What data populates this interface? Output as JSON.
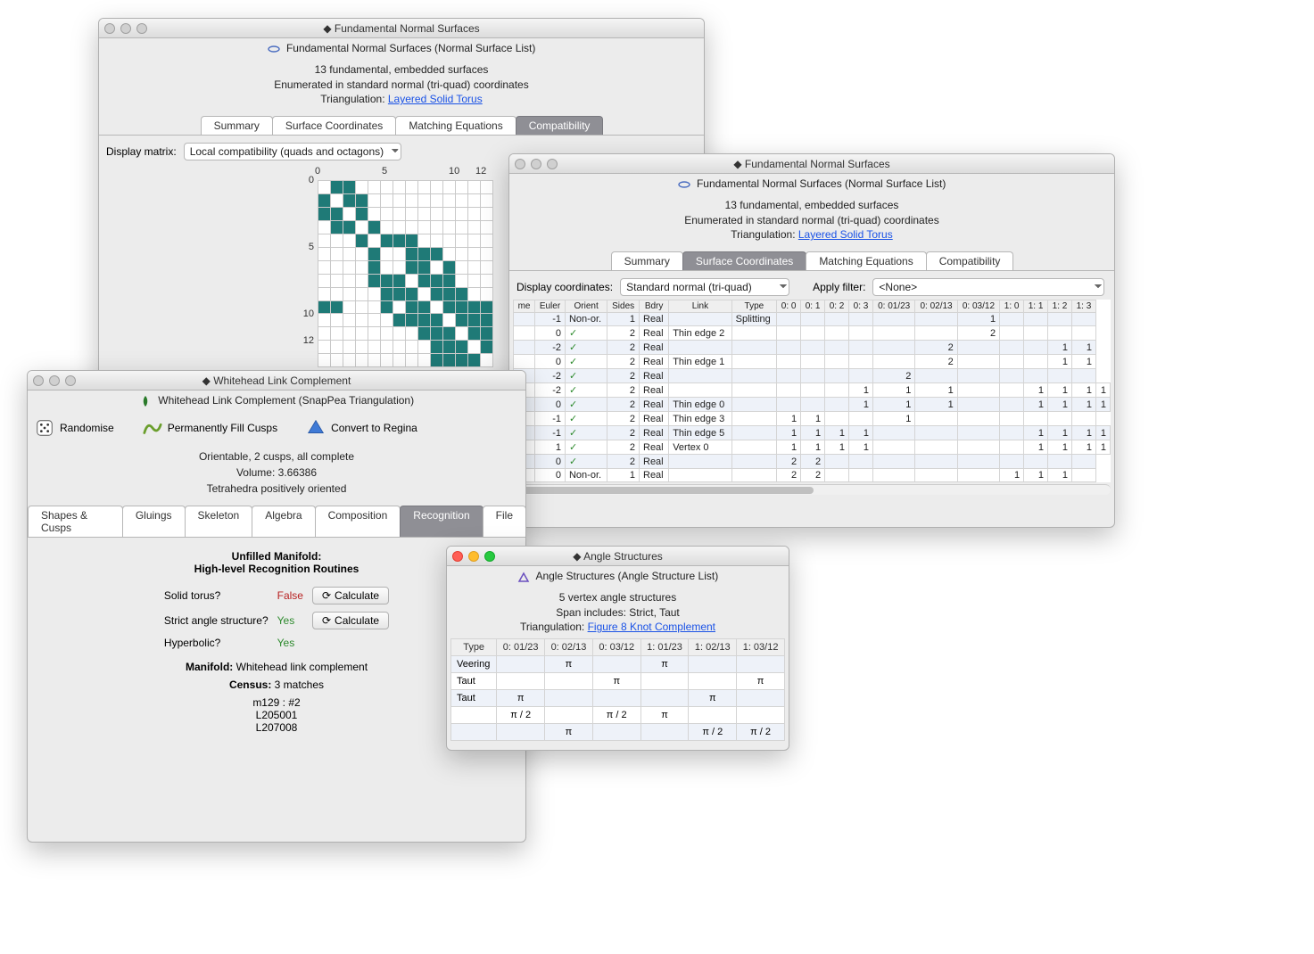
{
  "w1": {
    "title": "Fundamental Normal Surfaces",
    "subtitle": "Fundamental Normal Surfaces (Normal Surface List)",
    "summary1": "13 fundamental, embedded surfaces",
    "summary2": "Enumerated in standard normal (tri-quad) coordinates",
    "triangulation_label": "Triangulation:",
    "triangulation_link": "Layered Solid Torus",
    "tabs": [
      "Summary",
      "Surface Coordinates",
      "Matching Equations",
      "Compatibility"
    ],
    "active_tab": 3,
    "display_matrix_label": "Display matrix:",
    "display_matrix_value": "Local compatibility (quads and octagons)",
    "axis_ticks": [
      "0",
      "5",
      "10",
      "12"
    ],
    "matrix": [
      [
        0,
        1,
        1,
        0,
        0,
        0,
        0,
        0,
        0,
        0,
        0,
        0,
        0,
        0
      ],
      [
        1,
        0,
        1,
        1,
        0,
        0,
        0,
        0,
        0,
        0,
        0,
        0,
        0,
        0
      ],
      [
        1,
        1,
        0,
        1,
        0,
        0,
        0,
        0,
        0,
        0,
        0,
        0,
        0,
        0
      ],
      [
        0,
        1,
        1,
        0,
        1,
        0,
        0,
        0,
        0,
        0,
        0,
        0,
        0,
        0
      ],
      [
        0,
        0,
        0,
        1,
        0,
        1,
        1,
        1,
        0,
        0,
        0,
        0,
        0,
        0
      ],
      [
        0,
        0,
        0,
        0,
        1,
        0,
        0,
        1,
        1,
        1,
        0,
        0,
        0,
        0
      ],
      [
        0,
        0,
        0,
        0,
        1,
        0,
        0,
        1,
        1,
        0,
        1,
        0,
        0,
        0
      ],
      [
        0,
        0,
        0,
        0,
        1,
        1,
        1,
        0,
        1,
        1,
        1,
        0,
        0,
        0
      ],
      [
        0,
        0,
        0,
        0,
        0,
        1,
        1,
        1,
        0,
        1,
        1,
        1,
        0,
        0
      ],
      [
        1,
        1,
        0,
        0,
        0,
        1,
        0,
        1,
        1,
        0,
        1,
        1,
        1,
        1
      ],
      [
        0,
        0,
        0,
        0,
        0,
        0,
        1,
        1,
        1,
        1,
        0,
        1,
        1,
        1
      ],
      [
        0,
        0,
        0,
        0,
        0,
        0,
        0,
        0,
        1,
        1,
        1,
        0,
        1,
        1
      ],
      [
        0,
        0,
        0,
        0,
        0,
        0,
        0,
        0,
        0,
        1,
        1,
        1,
        0,
        1
      ],
      [
        0,
        0,
        0,
        0,
        0,
        0,
        0,
        0,
        0,
        1,
        1,
        1,
        1,
        0
      ]
    ]
  },
  "w2": {
    "title": "Fundamental Normal Surfaces",
    "subtitle": "Fundamental Normal Surfaces (Normal Surface List)",
    "summary1": "13 fundamental, embedded surfaces",
    "summary2": "Enumerated in standard normal (tri-quad) coordinates",
    "triangulation_label": "Triangulation:",
    "triangulation_link": "Layered Solid Torus",
    "tabs": [
      "Summary",
      "Surface Coordinates",
      "Matching Equations",
      "Compatibility"
    ],
    "active_tab": 1,
    "display_coord_label": "Display coordinates:",
    "display_coord_value": "Standard normal (tri-quad)",
    "filter_label": "Apply filter:",
    "filter_value": "<None>",
    "cols": [
      "me",
      "Euler",
      "Orient",
      "Sides",
      "Bdry",
      "Link",
      "Type",
      "0: 0",
      "0: 1",
      "0: 2",
      "0: 3",
      "0: 01/23",
      "0: 02/13",
      "0: 03/12",
      "1: 0",
      "1: 1",
      "1: 2",
      "1: 3"
    ],
    "rows": [
      {
        "euler": "-1",
        "orient": "Non-or.",
        "sides": "1",
        "bdry": "Real",
        "link": "",
        "type": "Splitting",
        "c": [
          "",
          "",
          "",
          "",
          "",
          "",
          "1",
          "",
          "",
          "",
          ""
        ]
      },
      {
        "euler": "0",
        "orient": "check",
        "sides": "2",
        "bdry": "Real",
        "link": "Thin edge 2",
        "type": "",
        "c": [
          "",
          "",
          "",
          "",
          "",
          "",
          "2",
          "",
          "",
          "",
          ""
        ]
      },
      {
        "euler": "-2",
        "orient": "check",
        "sides": "2",
        "bdry": "Real",
        "link": "",
        "type": "",
        "c": [
          "",
          "",
          "",
          "",
          "",
          "2",
          "",
          "",
          "",
          "1",
          "1"
        ]
      },
      {
        "euler": "0",
        "orient": "check",
        "sides": "2",
        "bdry": "Real",
        "link": "Thin edge 1",
        "type": "",
        "c": [
          "",
          "",
          "",
          "",
          "",
          "2",
          "",
          "",
          "",
          "1",
          "1"
        ]
      },
      {
        "euler": "-2",
        "orient": "check",
        "sides": "2",
        "bdry": "Real",
        "link": "",
        "type": "",
        "c": [
          "",
          "",
          "",
          "",
          "2",
          "",
          "",
          "",
          "",
          "",
          ""
        ]
      },
      {
        "euler": "-2",
        "orient": "check",
        "sides": "2",
        "bdry": "Real",
        "link": "",
        "type": "",
        "c": [
          "",
          "",
          "",
          "1",
          "1",
          "1",
          "",
          "",
          "1",
          "1",
          "1",
          "1"
        ]
      },
      {
        "euler": "0",
        "orient": "check",
        "sides": "2",
        "bdry": "Real",
        "link": "Thin edge 0",
        "type": "",
        "c": [
          "",
          "",
          "",
          "1",
          "1",
          "1",
          "",
          "",
          "1",
          "1",
          "1",
          "1"
        ]
      },
      {
        "euler": "-1",
        "orient": "check",
        "sides": "2",
        "bdry": "Real",
        "link": "Thin edge 3",
        "type": "",
        "c": [
          "1",
          "1",
          "",
          "",
          "1",
          "",
          "",
          "",
          "",
          "",
          ""
        ]
      },
      {
        "euler": "-1",
        "orient": "check",
        "sides": "2",
        "bdry": "Real",
        "link": "Thin edge 5",
        "type": "",
        "c": [
          "1",
          "1",
          "1",
          "1",
          "",
          "",
          "",
          "",
          "1",
          "1",
          "1",
          "1"
        ]
      },
      {
        "euler": "1",
        "orient": "check",
        "sides": "2",
        "bdry": "Real",
        "link": "Vertex 0",
        "type": "",
        "c": [
          "1",
          "1",
          "1",
          "1",
          "",
          "",
          "",
          "",
          "1",
          "1",
          "1",
          "1"
        ]
      },
      {
        "euler": "0",
        "orient": "check",
        "sides": "2",
        "bdry": "Real",
        "link": "",
        "type": "",
        "c": [
          "2",
          "2",
          "",
          "",
          "",
          "",
          "",
          "",
          "",
          "",
          ""
        ]
      },
      {
        "euler": "0",
        "orient": "Non-or.",
        "sides": "1",
        "bdry": "Real",
        "link": "",
        "type": "",
        "c": [
          "2",
          "2",
          "",
          "",
          "",
          "",
          "",
          "1",
          "1",
          "1",
          ""
        ]
      }
    ]
  },
  "w3": {
    "title": "Whitehead Link Complement",
    "subtitle": "Whitehead Link Complement (SnapPea Triangulation)",
    "tools": {
      "randomise": "Randomise",
      "fill": "Permanently Fill Cusps",
      "convert": "Convert to Regina"
    },
    "info1": "Orientable, 2 cusps, all complete",
    "info2": "Volume: 3.66386",
    "info3": "Tetrahedra positively oriented",
    "tabs": [
      "Shapes & Cusps",
      "Gluings",
      "Skeleton",
      "Algebra",
      "Composition",
      "Recognition",
      "File"
    ],
    "active_tab": 5,
    "recog_head1": "Unfilled Manifold:",
    "recog_head2": "High-level Recognition Routines",
    "solid_torus_label": "Solid torus?",
    "solid_torus_val": "False",
    "calc": "Calculate",
    "strict_label": "Strict angle structure?",
    "strict_val": "Yes",
    "hyp_label": "Hyperbolic?",
    "hyp_val": "Yes",
    "manifold_label": "Manifold:",
    "manifold_val": "Whitehead link complement",
    "census_label": "Census:",
    "census_val": "3 matches",
    "census_items": [
      "m129 : #2",
      "L205001",
      "L207008"
    ]
  },
  "w4": {
    "title": "Angle Structures",
    "subtitle": "Angle Structures (Angle Structure List)",
    "summary1": "5 vertex angle structures",
    "summary2": "Span includes: Strict, Taut",
    "triangulation_label": "Triangulation:",
    "triangulation_link": "Figure 8 Knot Complement",
    "cols": [
      "Type",
      "0: 01/23",
      "0: 02/13",
      "0: 03/12",
      "1: 01/23",
      "1: 02/13",
      "1: 03/12"
    ],
    "rows": [
      [
        "Veering",
        "",
        "π",
        "",
        "π",
        "",
        ""
      ],
      [
        "Taut",
        "",
        "",
        "π",
        "",
        "",
        "π"
      ],
      [
        "Taut",
        "π",
        "",
        "",
        "",
        "π",
        ""
      ],
      [
        "",
        "π / 2",
        "",
        "π / 2",
        "π",
        "",
        ""
      ],
      [
        "",
        "",
        "π",
        "",
        "",
        "π / 2",
        "π / 2"
      ]
    ]
  }
}
